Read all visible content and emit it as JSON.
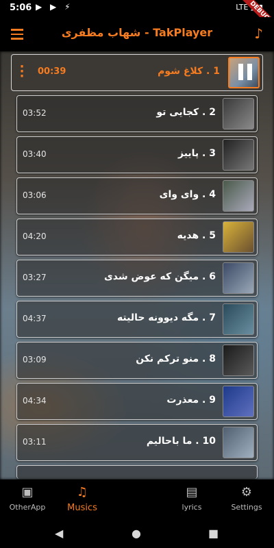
{
  "status_bar": {
    "time": "5:06",
    "network": "LTE",
    "debug_banner": "DEBUG"
  },
  "app_bar": {
    "title": "شهاب مظفری - TakPlayer"
  },
  "now_playing": {
    "title": "1 . کلاغ شوم",
    "duration": "00:39"
  },
  "tracks": [
    {
      "title": "2 . کجایی تو",
      "duration": "03:52"
    },
    {
      "title": "3 . پاییز",
      "duration": "03:40"
    },
    {
      "title": "4 . وای وای",
      "duration": "03:06"
    },
    {
      "title": "5 . هدیه",
      "duration": "04:20"
    },
    {
      "title": "6 . میگن که عوض شدی",
      "duration": "03:27"
    },
    {
      "title": "7 . مگه دیوونه حالیته",
      "duration": "04:37"
    },
    {
      "title": "8 . منو ترکم نکن",
      "duration": "03:09"
    },
    {
      "title": "9 . معذرت",
      "duration": "04:34"
    },
    {
      "title": "10 . ما باحالیم",
      "duration": "03:11"
    }
  ],
  "bottom_nav": {
    "other_app": "OtherApp",
    "musics": "Musics",
    "lyrics": "lyrics",
    "settings": "Settings"
  },
  "colors": {
    "accent": "#f57c20",
    "background": "#000000"
  }
}
